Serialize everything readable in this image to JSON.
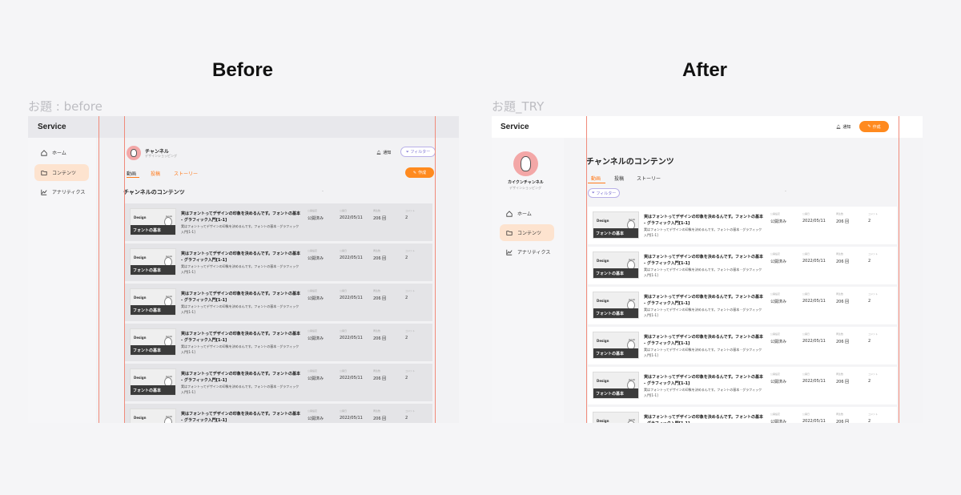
{
  "headings": {
    "before": "Before",
    "after": "After"
  },
  "labels": {
    "before": "お題 : before",
    "after": "お題_TRY"
  },
  "app": {
    "brand": "Service"
  },
  "nav": [
    {
      "label": "ホーム",
      "icon": "home-icon"
    },
    {
      "label": "コンテンツ",
      "icon": "folder-icon"
    },
    {
      "label": "アナリティクス",
      "icon": "chart-icon"
    }
  ],
  "channel": {
    "name_before": "チャンネル",
    "name_after": "カイクンチャンネル",
    "subtitle": "デザインショッピング"
  },
  "actions": {
    "notify": "通知",
    "filter": "フィルター",
    "create": "作成"
  },
  "tabs": [
    "動画",
    "投稿",
    "ストーリー"
  ],
  "section_title": "チャンネルのコンテンツ",
  "dash": "-",
  "columns": [
    "公開設定",
    "公開日",
    "再生数",
    "コメント"
  ],
  "row": {
    "title": "実はフォントってデザインの印象を決めるんです。フォントの基本 - グラフィック入門[1-1]",
    "desc": "実はフォントってデザインの印象を決めるんです。フォントの基本 - グラフィック入門[1-1]",
    "status": "公開済み",
    "date": "2022/05/11",
    "views": "206 回",
    "comments": "2",
    "thumb_text": "フォントの基本",
    "thumb_logo": "Design",
    "thumb_logo2": "Jacob"
  },
  "colors": {
    "accent": "#ff8a1f",
    "guide": "#f08a7a",
    "nav_active": "#fde3cf",
    "avatar": "#f3a7a7"
  }
}
